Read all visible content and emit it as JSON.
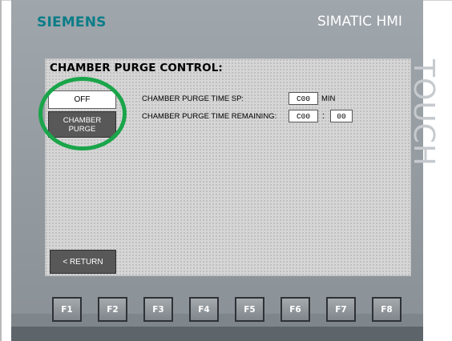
{
  "device": {
    "brand": "SIEMENS",
    "model": "SIMATIC HMI",
    "side_text": "TOUCH"
  },
  "screen": {
    "title": "CHAMBER PURGE CONTROL:",
    "off_button_label": "OFF",
    "purge_button_label": "CHAMBER\nPURGE",
    "time_sp_label": "CHAMBER PURGE TIME SP:",
    "time_sp_value": "C00",
    "time_sp_unit": "MIN",
    "time_remaining_label": "CHAMBER PURGE TIME REMAINING:",
    "time_remaining_minutes": "C00",
    "time_remaining_separator": ":",
    "time_remaining_seconds": "00",
    "return_label": "< RETURN"
  },
  "function_keys": [
    "F1",
    "F2",
    "F3",
    "F4",
    "F5",
    "F6",
    "F7",
    "F8"
  ],
  "colors": {
    "brand": "#0b7d88",
    "highlight_circle": "#1aa54a",
    "panel": "#9aa1a7"
  }
}
